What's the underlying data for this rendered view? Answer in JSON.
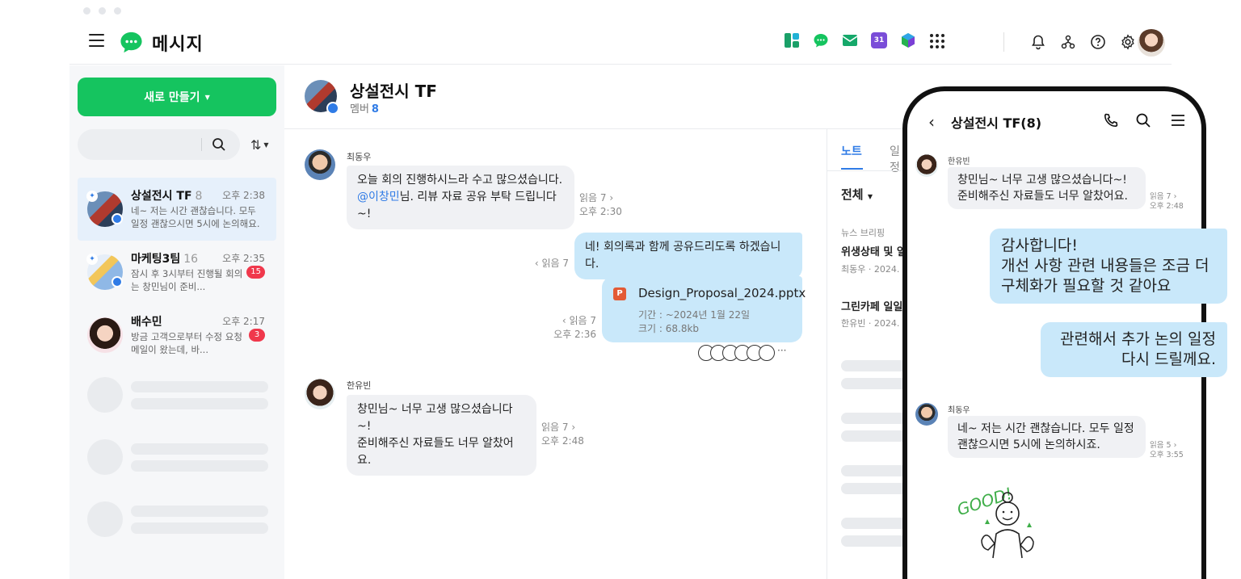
{
  "app": {
    "title": "메시지"
  },
  "colors": {
    "accent": "#15c45f",
    "brand_blue": "#2f7be6",
    "unread": "#f0384c",
    "outgoing_bubble": "#c9e8fa",
    "incoming_bubble": "#f0f1f4"
  },
  "topbar": {
    "apps": [
      "layout-icon",
      "message-app-icon",
      "mail-icon",
      "calendar-icon",
      "drive-icon",
      "app-grid-icon"
    ],
    "calendar_day": "31",
    "tools": [
      "bell-icon",
      "org-chart-icon",
      "help-icon",
      "gear-icon",
      "profile-avatar"
    ]
  },
  "sidebar": {
    "new_button": "새로 만들기",
    "chats": [
      {
        "name": "상설전시 TF",
        "count": "8",
        "time": "오후 2:38",
        "preview": "네~ 저는 시간 괜찮습니다. 모두 일정 괜찮으시면 5시에 논의해요.",
        "unread": ""
      },
      {
        "name": "마케팅3팀",
        "count": "16",
        "time": "오후 2:35",
        "preview": "잠시 후 3시부터 진행될 회의는 창민님이 준비...",
        "unread": "15"
      },
      {
        "name": "배수민",
        "count": "",
        "time": "오후 2:17",
        "preview": "방금 고객으로부터 수정 요청 메일이 왔는데, 바...",
        "unread": "3"
      }
    ]
  },
  "chat": {
    "title": "상설전시 TF",
    "members_label": "멤버",
    "members_count": "8",
    "messages": {
      "m1": {
        "sender": "최동우",
        "line1": "오늘 회의 진행하시느라 수고 많으셨습니다.",
        "mention": "@이창민",
        "line2_rest": "님. 리뷰 자료 공유 부탁 드립니다~!",
        "read": "읽음 7 ›",
        "time": "오후 2:30"
      },
      "m2": {
        "text": "네! 회의록과 함께 공유드리도록 하겠습니다.",
        "read": "‹ 읽음 7"
      },
      "m3": {
        "file_name": "Design_Proposal_2024.pptx",
        "period": "기간 : ~2024년 1월 22일",
        "size": "크기 : 68.8kb",
        "read": "‹ 읽음 7",
        "time": "오후 2:36",
        "file_badge": "P",
        "more": "···"
      },
      "m4": {
        "sender": "한유빈",
        "line1": "창민님~ 너무 고생 많으셨습니다~!",
        "line2": "준비해주신 자료들도 너무 알찼어요.",
        "read": "읽음 7 ›",
        "time": "오후 2:48"
      }
    }
  },
  "right_panel": {
    "tab_note": "노트",
    "tab_other": "일정",
    "filter": "전체",
    "item1_tag": "뉴스 브리핑",
    "item1_title": "위생상태 및 일",
    "item1_meta": "최동우 · 2024.",
    "item2_title": "그린카페 일일",
    "item2_meta": "한유빈 · 2024."
  },
  "phone": {
    "title": "상설전시 TF(8)",
    "msg1": {
      "sender": "한유빈",
      "line1": "창민님~ 너무 고생 많으셨습니다~!",
      "line2": "준비해주신 자료들도 너무 알찼어요.",
      "read": "읽음 7 ›",
      "time": "오후 2:48"
    },
    "msg2": {
      "line1": "감사합니다!",
      "line2": "개선 사항 관련 내용들은 조금 더",
      "line3": "구체화가 필요할 것 같아요"
    },
    "msg3": {
      "line1": "관련해서 추가 논의 일정",
      "line2": "다시 드릴께요."
    },
    "msg4": {
      "sender": "최동우",
      "line1": "네~ 저는 시간 괜찮습니다. 모두 일정",
      "line2": "괜찮으시면 5시에 논의하시죠.",
      "read": "읽음 5 ›",
      "time": "오후 3:55"
    },
    "sticker_text": "GOOD!"
  }
}
